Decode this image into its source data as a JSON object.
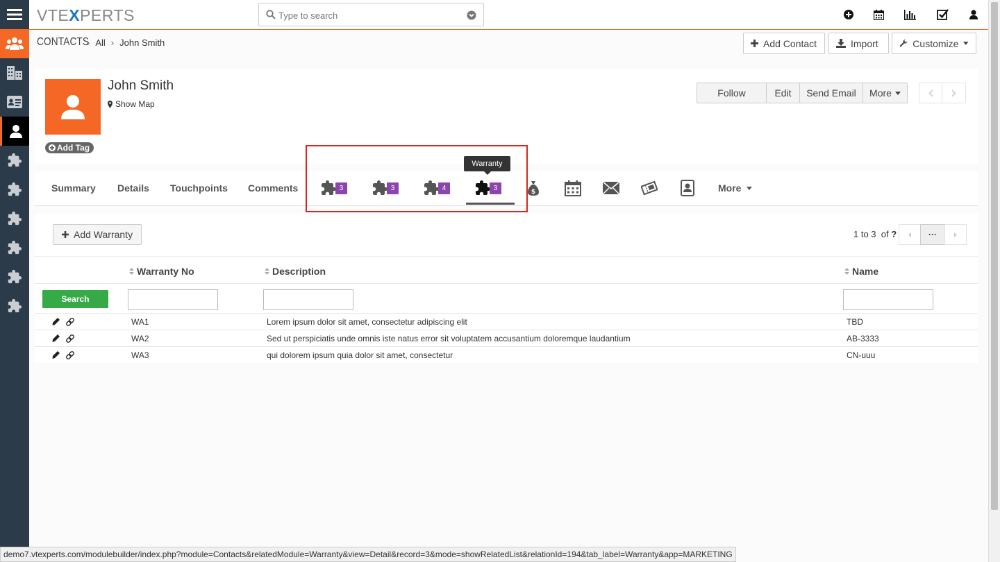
{
  "app": {
    "logo_pre": "VTE",
    "logo_x": "X",
    "logo_post": "PERTS"
  },
  "search": {
    "placeholder": "Type to search"
  },
  "breadcrumb": {
    "module": "CONTACTS",
    "all": "All",
    "record": "John Smith"
  },
  "header_buttons": {
    "add_contact": "Add Contact",
    "import": "Import",
    "customize": "Customize"
  },
  "record": {
    "name": "John Smith",
    "show_map": "Show Map",
    "add_tag": "Add Tag"
  },
  "record_actions": {
    "follow": "Follow",
    "edit": "Edit",
    "send_email": "Send Email",
    "more": "More"
  },
  "tabs": {
    "summary": "Summary",
    "details": "Details",
    "touchpoints": "Touchpoints",
    "comments": "Comments",
    "module_badges": [
      "3",
      "3",
      "4",
      "3"
    ],
    "more": "More",
    "tooltip": "Warranty"
  },
  "related": {
    "add_button": "Add Warranty",
    "pager_range": "1 to 3",
    "pager_of": "of",
    "pager_total": "?",
    "pager_more": "···",
    "search_button": "Search",
    "columns": [
      "Warranty No",
      "Description",
      "Name"
    ],
    "rows": [
      {
        "no": "WA1",
        "desc": "Lorem ipsum dolor sit amet, consectetur adipiscing elit",
        "name": "TBD"
      },
      {
        "no": "WA2",
        "desc": "Sed ut perspiciatis unde omnis iste natus error sit voluptatem accusantium doloremque laudantium",
        "name": "AB-3333"
      },
      {
        "no": "WA3",
        "desc": "qui dolorem ipsum quia dolor sit amet, consectetur",
        "name": "CN-uuu"
      }
    ]
  },
  "status_url": "demo7.vtexperts.com/modulebuilder/index.php?module=Contacts&relatedModule=Warranty&view=Detail&record=3&mode=showRelatedList&relationId=194&tab_label=Warranty&app=MARKETING",
  "colors": {
    "accent": "#f46725",
    "rail": "#2c3b49",
    "badge": "#8e44ad",
    "search_btn": "#35aa47",
    "highlight": "#d9251d"
  },
  "icons": [
    "menu-icon",
    "users-icon",
    "building-icon",
    "id-card-icon",
    "contact-icon",
    "puzzle-icon",
    "search-icon",
    "chevron-down-icon",
    "plus-circle-icon",
    "calendar-icon",
    "bar-chart-icon",
    "checkbox-icon",
    "user-icon",
    "money-bag-icon",
    "envelope-icon",
    "ticket-icon",
    "address-book-icon",
    "pencil-icon",
    "link-icon",
    "map-marker-icon"
  ]
}
